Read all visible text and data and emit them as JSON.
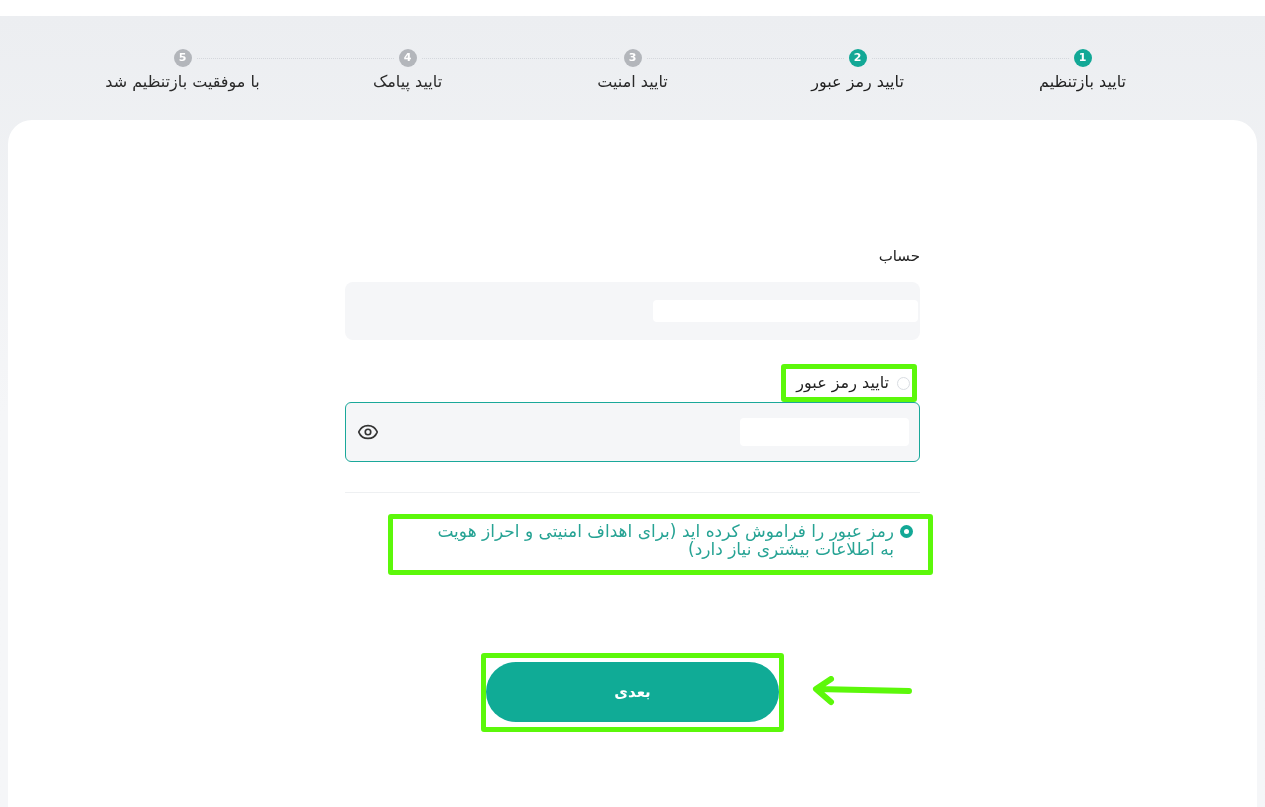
{
  "steps": [
    {
      "number": "1",
      "label": "تایید بازتنظیم",
      "active": true
    },
    {
      "number": "2",
      "label": "تایید رمز عبور",
      "active": true
    },
    {
      "number": "3",
      "label": "تایید امنیت",
      "active": false
    },
    {
      "number": "4",
      "label": "تایید پیامک",
      "active": false
    },
    {
      "number": "5",
      "label": "با موفقیت بازتنظیم شد",
      "active": false
    }
  ],
  "form": {
    "account": {
      "label": "حساب"
    },
    "password_options": [
      {
        "label": "تایید رمز عبور",
        "selected": false,
        "highlighted": true
      },
      {
        "label": "رمز عبور را فراموش کرده اید (برای اهداف امنیتی و احراز هویت به اطلاعات بیشتری نیاز دارد)",
        "selected": true,
        "highlighted": true
      }
    ],
    "password_field": {
      "focused": true
    },
    "next_button": {
      "label": "بعدی",
      "highlighted": true,
      "arrow": true
    }
  }
}
